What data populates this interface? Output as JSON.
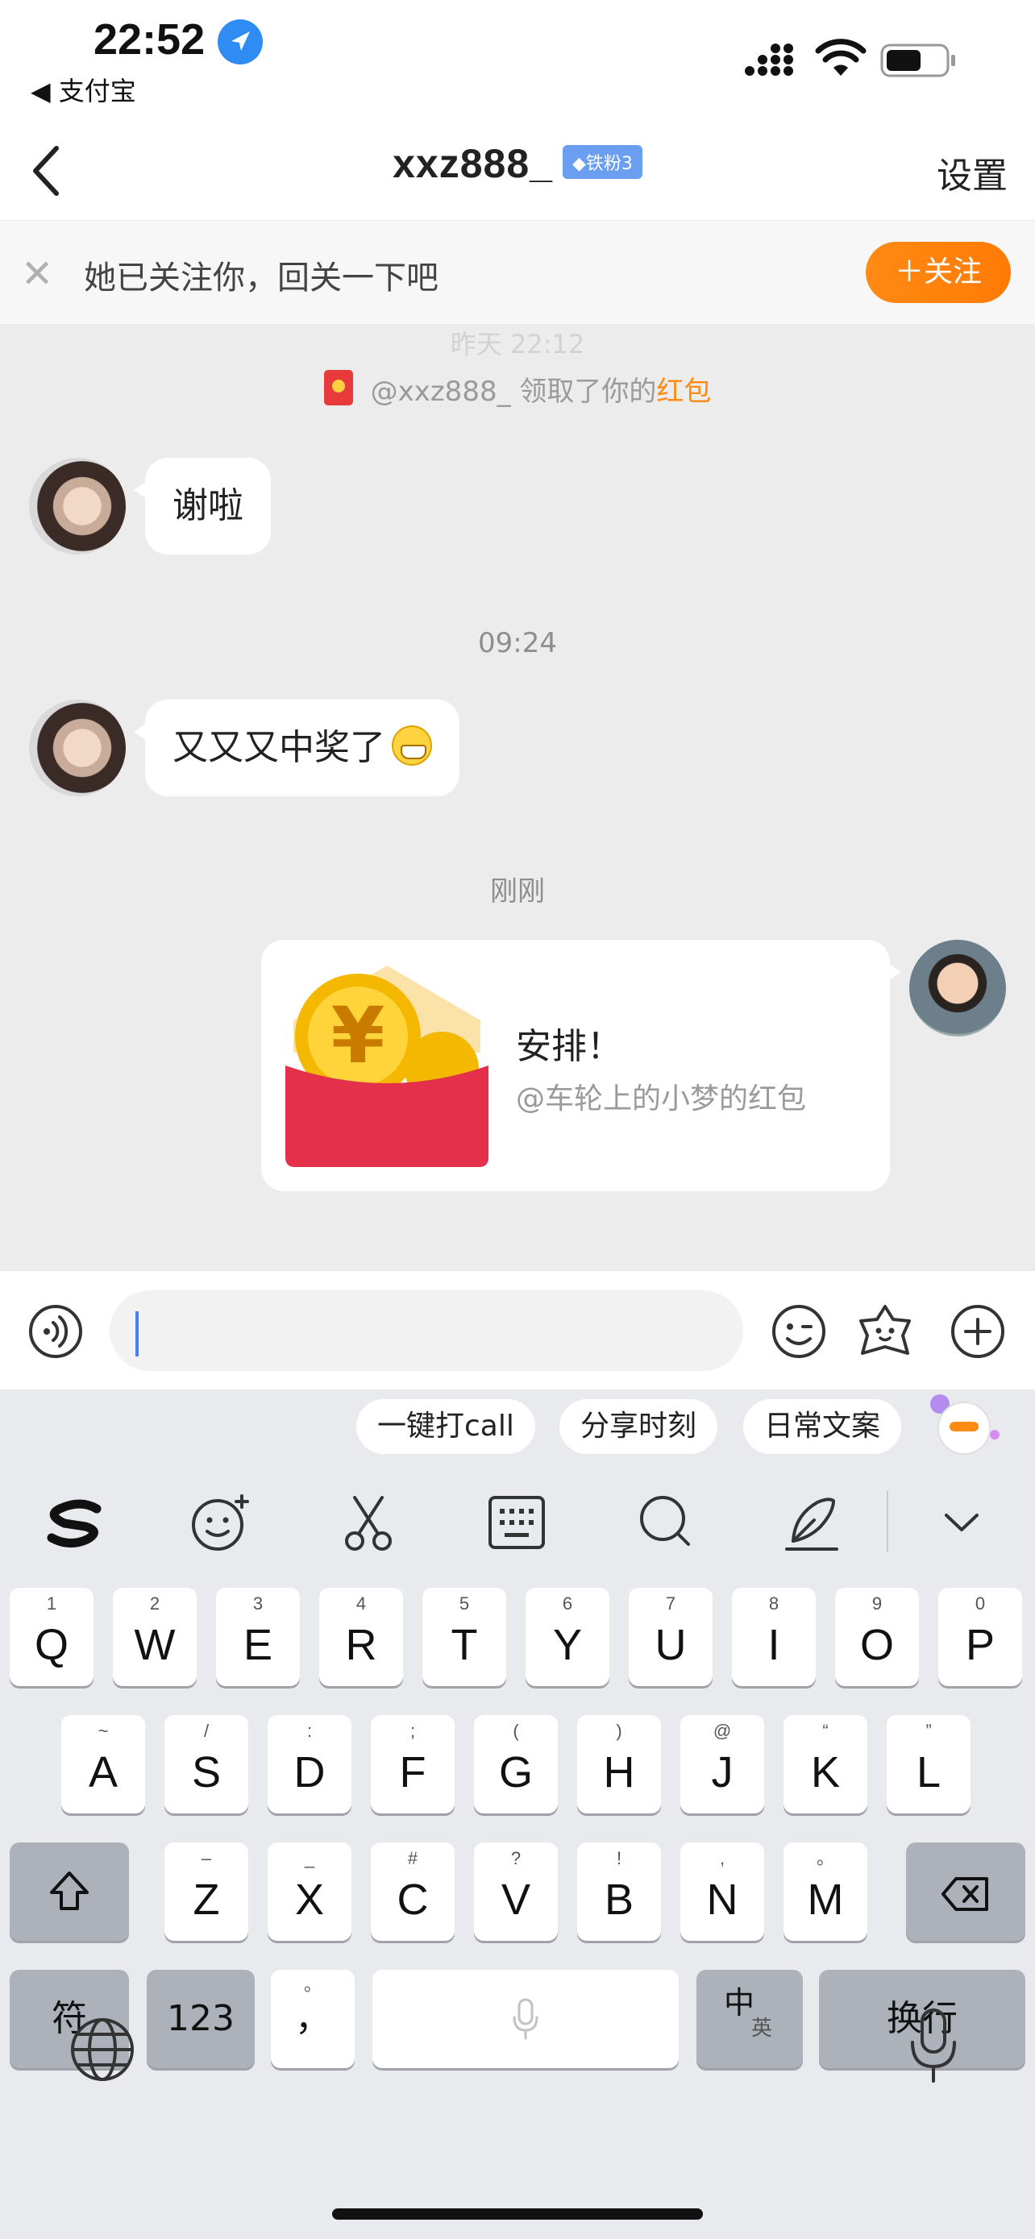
{
  "status": {
    "time": "22:52",
    "back_app": "◀ 支付宝"
  },
  "header": {
    "title": "xxz888_",
    "fan_badge": "◆铁粉3",
    "settings": "设置"
  },
  "follow_bar": {
    "text": "她已关注你，回关一下吧",
    "button": "＋关注",
    "accent": "#ff8a14"
  },
  "chat": {
    "faded_time": "昨天 22:12",
    "notice": {
      "prefix": "@xxz888_ 领取了你的",
      "link": "红包"
    },
    "messages": [
      {
        "from": "other",
        "text": "谢啦"
      },
      {
        "timestamp": "09:24"
      },
      {
        "from": "other",
        "text": "又又又中奖了",
        "emoji": "grinning-face-icon"
      },
      {
        "timestamp": "刚刚"
      },
      {
        "from": "me",
        "type": "red-packet",
        "title": "安排！",
        "subtitle": "@车轮上的小梦的红包"
      }
    ]
  },
  "input": {
    "value": "",
    "placeholder": ""
  },
  "keyboard": {
    "suggestions": [
      "一键打call",
      "分享时刻",
      "日常文案"
    ],
    "row1": [
      {
        "k": "Q",
        "h": "1"
      },
      {
        "k": "W",
        "h": "2"
      },
      {
        "k": "E",
        "h": "3"
      },
      {
        "k": "R",
        "h": "4"
      },
      {
        "k": "T",
        "h": "5"
      },
      {
        "k": "Y",
        "h": "6"
      },
      {
        "k": "U",
        "h": "7"
      },
      {
        "k": "I",
        "h": "8"
      },
      {
        "k": "O",
        "h": "9"
      },
      {
        "k": "P",
        "h": "0"
      }
    ],
    "row2": [
      {
        "k": "A",
        "h": "~"
      },
      {
        "k": "S",
        "h": "/"
      },
      {
        "k": "D",
        "h": ":"
      },
      {
        "k": "F",
        "h": ";"
      },
      {
        "k": "G",
        "h": "("
      },
      {
        "k": "H",
        "h": ")"
      },
      {
        "k": "J",
        "h": "@"
      },
      {
        "k": "K",
        "h": "“"
      },
      {
        "k": "L",
        "h": "”"
      }
    ],
    "row3": [
      {
        "k": "Z",
        "h": "–"
      },
      {
        "k": "X",
        "h": "_"
      },
      {
        "k": "C",
        "h": "#"
      },
      {
        "k": "V",
        "h": "?"
      },
      {
        "k": "B",
        "h": "!"
      },
      {
        "k": "N",
        "h": ","
      },
      {
        "k": "M",
        "h": "。"
      }
    ],
    "symbol_key": "符",
    "num_key": "123",
    "punct_key": "，",
    "punct_hint": "。",
    "lang_key_main": "中",
    "lang_key_sub": "英",
    "enter_key": "换行"
  }
}
